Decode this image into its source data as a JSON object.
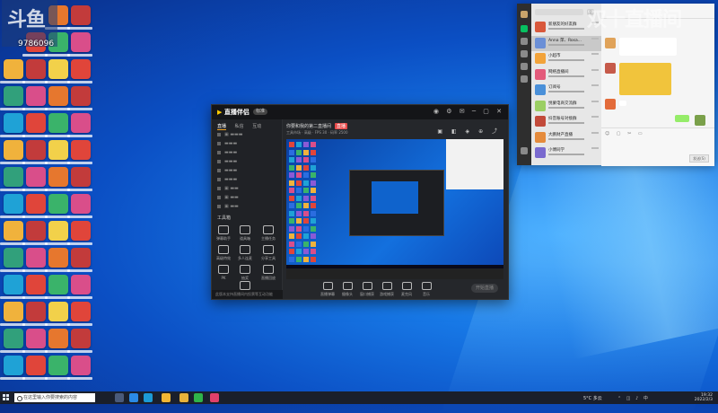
{
  "watermark": {
    "logo_text": "斗鱼",
    "room_number": "9786096",
    "right_text": "双十直播间"
  },
  "app": {
    "logo_main": "直播伴侣",
    "badge": "标准",
    "side_tabs": [
      "直播",
      "私信",
      "互动"
    ],
    "tools_label": "工具箱",
    "tools": [
      "弹幕助手",
      "道具箱",
      "主播任务",
      "高级特效",
      "多人连麦",
      "分享工具",
      "PK",
      "抽奖",
      "直播回放",
      "更多"
    ],
    "side_footer": "此版本支持直播间内投票等互动功能",
    "title": "你要和我的第二直播间",
    "live_tag": "直播",
    "sub_info": "工具市场 · 高级 · FPS 30 · 码率 2500",
    "controls": [
      "直播弹幕",
      "摄像头",
      "窗口捕获",
      "游戏捕获",
      "麦克风",
      "音乐"
    ],
    "go_live": "开始直播"
  },
  "wechat": {
    "chats": [
      {
        "name": "新朋友的好友群",
        "color": "#d9583b"
      },
      {
        "name": "Anna 萍、Rosa...",
        "color": "#6b8fd6"
      },
      {
        "name": "小超市",
        "color": "#f2a33a"
      },
      {
        "name": "网络直播间",
        "color": "#e35a7a"
      },
      {
        "name": "订阅号",
        "color": "#4a90d9"
      },
      {
        "name": "悦蒙电商交流群",
        "color": "#9bcf63"
      },
      {
        "name": "抖音账号对接群",
        "color": "#c24a3a"
      },
      {
        "name": "大鹏财产直播",
        "color": "#e58b3c"
      },
      {
        "name": "小傅同学",
        "color": "#7a6acf"
      }
    ],
    "chat_title": "大家",
    "send_label": "发送(S)"
  },
  "taskbar": {
    "search_placeholder": "在这里输入你要搜索的内容",
    "weather": "5°C 多云",
    "time": "19:32",
    "date": "2022/2/3"
  }
}
